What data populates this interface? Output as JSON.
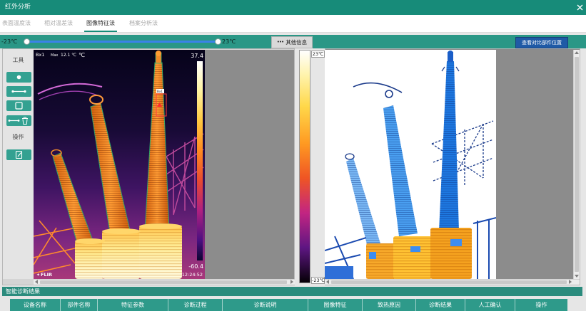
{
  "window": {
    "title": "红外分析",
    "close_icon": "close-icon"
  },
  "tabs": [
    {
      "label": "表面温度法",
      "active": false
    },
    {
      "label": "相对温差法",
      "active": false
    },
    {
      "label": "图像特征法",
      "active": true
    },
    {
      "label": "档案分析法",
      "active": false
    }
  ],
  "range": {
    "min_label": "-23℃",
    "max_label": "23℃",
    "min": -23,
    "max": 23,
    "low": -23,
    "high": 23
  },
  "buttons": {
    "other_info_icon": "more-dots-icon",
    "other_info": "其他信息",
    "compare": "查看对比部件位置"
  },
  "toolbar": {
    "tools_label": "工具",
    "ops_label": "操作",
    "tools": [
      {
        "icon": "point-icon"
      },
      {
        "icon": "line-icon"
      },
      {
        "icon": "rectangle-icon"
      },
      {
        "icon": "line-delete-icon"
      }
    ],
    "ops": [
      {
        "icon": "edit-document-icon"
      }
    ]
  },
  "thermal": {
    "box_id": "Bx1",
    "max_label": "Max",
    "max_value": "12.1 ℃",
    "unit": "℃",
    "scale_max": "37.4",
    "scale_min": "-60.4",
    "brand": "FLIR",
    "time": "12:24:52"
  },
  "scale": {
    "top": "23℃",
    "bottom": "-23℃"
  },
  "results": {
    "title": "智能诊断结果",
    "columns": [
      "设备名称",
      "部件名称",
      "特征参数",
      "诊断过程",
      "诊断说明",
      "图像特征",
      "致热原因",
      "诊断结果",
      "人工确认",
      "操作"
    ]
  },
  "colors": {
    "header": "#178b79",
    "band": "#2a9786",
    "slider": "#3b82e8",
    "button_teal": "#33a191",
    "compare_button": "#1f5aa6",
    "results_bar": "#2b8b7d",
    "table_header": "#2e9a8a"
  }
}
